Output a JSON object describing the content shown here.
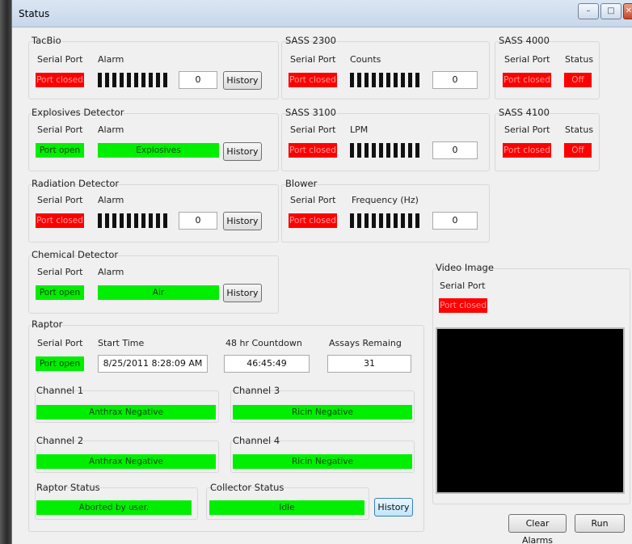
{
  "window": {
    "title": "Status",
    "min": "–",
    "max": "□",
    "close": "✕"
  },
  "common": {
    "serial_port": "Serial Port",
    "alarm": "Alarm",
    "history": "History",
    "port_closed": "Port closed",
    "port_open": "Port open",
    "status": "Status",
    "off": "Off"
  },
  "tacbio": {
    "title": "TacBio",
    "value": "0"
  },
  "explosives": {
    "title": "Explosives Detector",
    "alarm": "Explosives"
  },
  "radiation": {
    "title": "Radiation Detector",
    "value": "0"
  },
  "chemical": {
    "title": "Chemical Detector",
    "alarm": "Air"
  },
  "sass2300": {
    "title": "SASS 2300",
    "col": "Counts",
    "value": "0"
  },
  "sass3100": {
    "title": "SASS 3100",
    "col": "LPM",
    "value": "0"
  },
  "blower": {
    "title": "Blower",
    "col": "Frequency (Hz)",
    "value": "0"
  },
  "sass4000": {
    "title": "SASS 4000"
  },
  "sass4100": {
    "title": "SASS 4100"
  },
  "video": {
    "title": "Video Image"
  },
  "raptor": {
    "title": "Raptor",
    "start_time_label": "Start Time",
    "start_time": "8/25/2011 8:28:09 AM",
    "countdown_label": "48 hr Countdown",
    "countdown": "46:45:49",
    "assays_label": "Assays Remaing",
    "assays": "31",
    "ch1_label": "Channel 1",
    "ch1": "Anthrax Negative",
    "ch2_label": "Channel 2",
    "ch2": "Anthrax Negative",
    "ch3_label": "Channel 3",
    "ch3": "Ricin Negative",
    "ch4_label": "Channel 4",
    "ch4": "Ricin Negative",
    "raptor_status_label": "Raptor Status",
    "raptor_status": "Aborted by user.",
    "collector_status_label": "Collector Status",
    "collector_status": "Idle"
  },
  "actions": {
    "clear_alarms": "Clear Alarms",
    "run": "Run"
  },
  "colors": {
    "closed": "#ff0000",
    "open": "#00ee00"
  }
}
